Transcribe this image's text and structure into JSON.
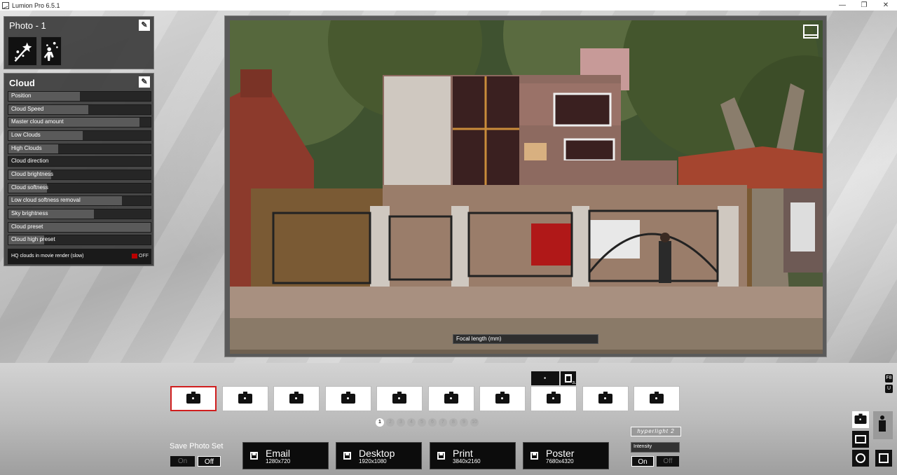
{
  "window": {
    "title": "Lumion Pro 6.5.1",
    "minimize": "—",
    "maximize": "❐",
    "close": "✕"
  },
  "photo_panel": {
    "title": "Photo - 1",
    "effects": [
      "add-effect-icon",
      "remove-effect-icon"
    ]
  },
  "cloud_panel": {
    "title": "Cloud",
    "sliders": [
      {
        "label": "Position",
        "level": 0.5
      },
      {
        "label": "Cloud Speed",
        "level": 0.56
      },
      {
        "label": "Master cloud amount",
        "level": 0.92
      },
      {
        "label": "Low Clouds",
        "level": 0.52
      },
      {
        "label": "High Clouds",
        "level": 0.35
      },
      {
        "label": "Cloud direction",
        "level": 0.0
      },
      {
        "label": "Cloud brightness",
        "level": 0.3
      },
      {
        "label": "Cloud softness",
        "level": 0.27
      },
      {
        "label": "Low cloud softness removal",
        "level": 0.8
      },
      {
        "label": "Sky brightness",
        "level": 0.6
      },
      {
        "label": "Cloud preset",
        "level": 1.0
      },
      {
        "label": "Cloud high preset",
        "level": 0.25
      }
    ],
    "hq_label": "HQ clouds in movie render (slow)",
    "hq_state": "OFF"
  },
  "viewport": {
    "focal_label": "Focal length (mm)"
  },
  "photo_set": {
    "slots": 10,
    "active_slot": 1,
    "pages": [
      "1",
      "2",
      "3",
      "4",
      "5",
      "6",
      "7",
      "8",
      "9",
      "10"
    ],
    "active_page": "1"
  },
  "save_photo_set": {
    "label": "Save Photo Set",
    "on": "On",
    "off": "Off"
  },
  "render_buttons": [
    {
      "title": "Email",
      "size": "1280x720"
    },
    {
      "title": "Desktop",
      "size": "1920x1080"
    },
    {
      "title": "Print",
      "size": "3840x2160"
    },
    {
      "title": "Poster",
      "size": "7680x4320"
    }
  ],
  "hyperlight": {
    "logo": "hyperlight 2",
    "intensity_label": "Intensity",
    "on": "On",
    "off": "Off"
  },
  "shortcuts": {
    "f8": "F8",
    "u": "U",
    "trash_badge": "2L"
  },
  "colors": {
    "accent_red": "#d01e1e",
    "panel_bg": "#3c3c3c"
  }
}
